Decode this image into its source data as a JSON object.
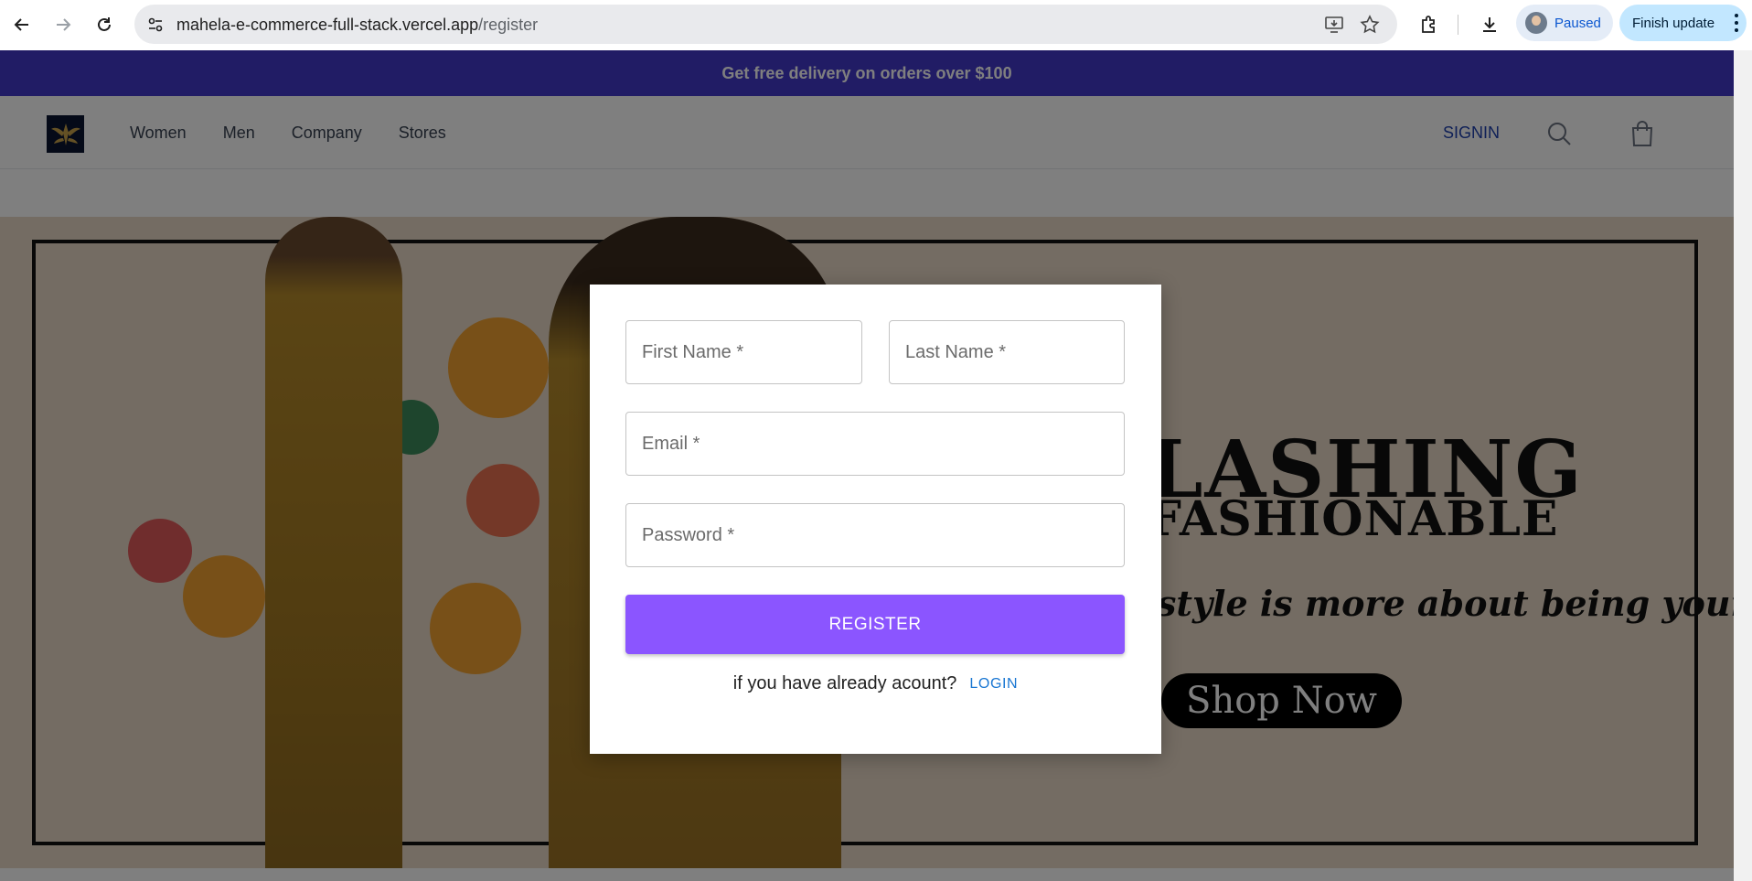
{
  "browser": {
    "url_host": "mahela-e-commerce-full-stack.vercel.app",
    "url_path": "/register",
    "profile_status": "Paused",
    "update_label": "Finish update",
    "icons": [
      "back-icon",
      "forward-icon",
      "reload-icon",
      "site-info-icon",
      "install-app-icon",
      "bookmark-star-icon",
      "extensions-icon",
      "downloads-icon",
      "menu-icon"
    ]
  },
  "promo": {
    "text": "Get free delivery on orders over $100",
    "background": "#4338ca"
  },
  "header": {
    "nav": [
      "Women",
      "Men",
      "Company",
      "Stores"
    ],
    "signin_label": "SIGNIN"
  },
  "hero": {
    "title_line1": "LASHING",
    "title_line2": "FASHIONABLE",
    "tagline": "style is more about being yourself.",
    "cta_label": "Shop Now"
  },
  "register_form": {
    "first_name_placeholder": "First Name *",
    "last_name_placeholder": "Last Name *",
    "email_placeholder": "Email *",
    "password_placeholder": "Password *",
    "submit_label": "REGISTER",
    "login_prompt": "if you have already acount?",
    "login_link": "LOGIN",
    "accent": "#8b55ff"
  }
}
